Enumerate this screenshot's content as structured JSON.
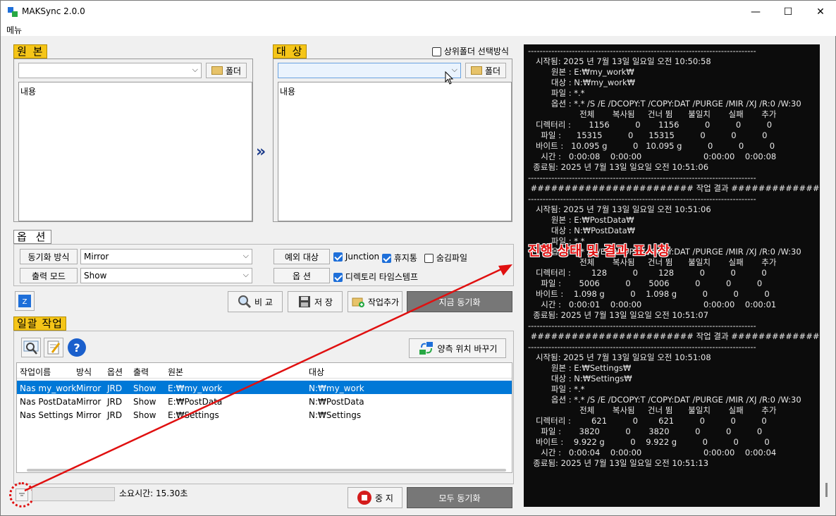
{
  "window": {
    "title": "MAKSync 2.0.0",
    "minimize": "—",
    "maximize": "☐",
    "close": "✕"
  },
  "menu": {
    "label": "메뉴"
  },
  "source": {
    "tag": "원 본",
    "path_value": "",
    "folder_button": "폴더",
    "content": "내용"
  },
  "target": {
    "tag": "대 상",
    "path_value": "",
    "folder_button": "폴더",
    "content": "내용",
    "parent_folder_option": "상위폴더 선택방식"
  },
  "arrow": "»",
  "options": {
    "tag": "옵 션",
    "sync_mode_button": "동기화 방식",
    "sync_mode_value": "Mirror",
    "output_mode_button": "출력 모드",
    "output_mode_value": "Show",
    "exclude_button": "예외 대상",
    "options_button": "옵 션",
    "junction": "Junction",
    "recycle": "휴지통",
    "hidden": "숨김파일",
    "dir_timestamp": "디렉토리 타임스템프"
  },
  "toolbar": {
    "compare": "비 교",
    "save": "저 장",
    "add_job": "작업추가",
    "sync_now": "지금 동기화"
  },
  "batch": {
    "tag": "일괄 작업",
    "swap_button": "양측 위치 바꾸기",
    "columns": [
      "작업이름",
      "방식",
      "옵션",
      "출력",
      "원본",
      "대상"
    ],
    "rows": [
      {
        "name": "Nas my_work",
        "mode": "Mirror",
        "opt": "JRD",
        "out": "Show",
        "src": "E:₩my_work",
        "dst": "N:₩my_work"
      },
      {
        "name": "Nas PostData",
        "mode": "Mirror",
        "opt": "JRD",
        "out": "Show",
        "src": "E:₩PostData",
        "dst": "N:₩PostData"
      },
      {
        "name": "Nas Settings",
        "mode": "Mirror",
        "opt": "JRD",
        "out": "Show",
        "src": "E:₩Settings",
        "dst": "N:₩Settings"
      }
    ]
  },
  "footer": {
    "elapsed": "소요시간: 15.30초",
    "stop": "중 지",
    "sync_all": "모두 동기화"
  },
  "annotation": "진행 상태 및 결과 표시창",
  "console_text": "------------------------------------------------------------------------------\n   시작됨: 2025 년 7월 13일 일요일 오전 10:50:58\n         원본 : E:₩my_work₩\n         대상 : N:₩my_work₩\n         파일 : *.*\n         옵션 : *.* /S /E /DCOPY:T /COPY:DAT /PURGE /MIR /XJ /R:0 /W:30\n                    전체       복사됨     건너 뜀      불일치       실패       추가\n   디렉터리 :       1156          0       1156          0          0          0\n     파일 :      15315          0      15315          0          0          0\n   바이트 :   10.095 g          0   10.095 g          0          0          0\n     시간 :   0:00:08    0:00:00                        0:00:00    0:00:08\n  종료됨: 2025 년 7월 13일 일요일 오전 10:51:06\n------------------------------------------------------------------------------\n ######################## 작업 결과 ########################\n------------------------------------------------------------------------------\n   시작됨: 2025 년 7월 13일 일요일 오전 10:51:06\n         원본 : E:₩PostData₩\n         대상 : N:₩PostData₩\n         파일 : *.*\n         옵션 : *.* /S /E /DCOPY:T /COPY:DAT /PURGE /MIR /XJ /R:0 /W:30\n                    전체       복사됨     건너 뜀      불일치       실패       추가\n   디렉터리 :        128          0        128          0          0          0\n     파일 :       5006          0       5006          0          0          0\n   바이트 :    1.098 g          0    1.098 g          0          0          0\n     시간 :   0:00:01    0:00:00                        0:00:00    0:00:01\n  종료됨: 2025 년 7월 13일 일요일 오전 10:51:07\n------------------------------------------------------------------------------\n ######################## 작업 결과 ########################\n------------------------------------------------------------------------------\n   시작됨: 2025 년 7월 13일 일요일 오전 10:51:08\n         원본 : E:₩Settings₩\n         대상 : N:₩Settings₩\n         파일 : *.*\n         옵션 : *.* /S /E /DCOPY:T /COPY:DAT /PURGE /MIR /XJ /R:0 /W:30\n                    전체       복사됨     건너 뜀      불일치       실패       추가\n   디렉터리 :        621          0        621          0          0          0\n     파일 :       3820          0       3820          0          0          0\n   바이트 :    9.922 g          0    9.922 g          0          0          0\n     시간 :   0:00:04    0:00:00                        0:00:00    0:00:04\n  종료됨: 2025 년 7월 13일 일요일 오전 10:51:13",
  "colors": {
    "accent_tag": "#f5c518",
    "selection": "#0078d7",
    "annotation": "#e01010",
    "console_bg": "#0c0c0c"
  }
}
